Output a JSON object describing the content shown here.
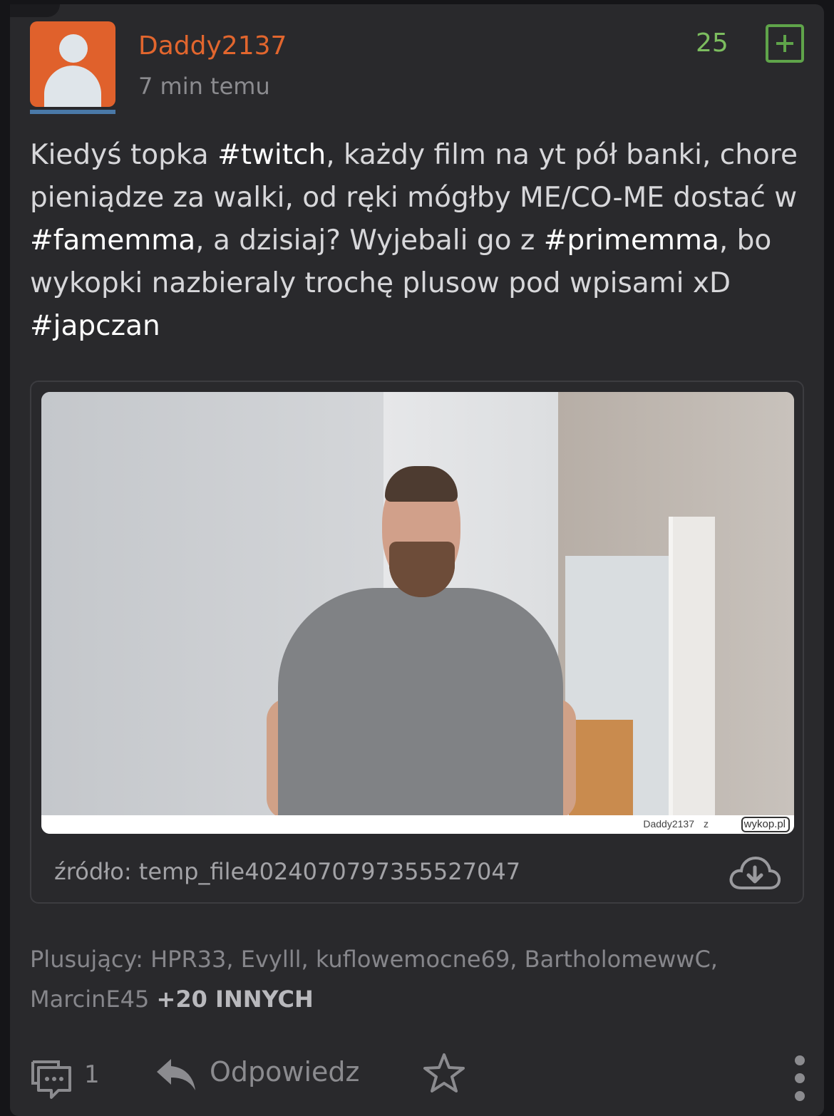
{
  "post": {
    "author": "Daddy2137",
    "time": "7 min temu",
    "votes": "25",
    "text_parts": {
      "p1": "Kiedyś topka ",
      "t1": "#twitch",
      "p2": ", każdy film na yt pół banki, chore pieniądze za walki, od ręki mógłby ME/CO-ME dostać w ",
      "t2": "#famemma",
      "p3": ", a dzisiaj? Wyjebali go z ",
      "t3": "#primemma",
      "p4": ", bo wykopki nazbieraly trochę plusow pod wpisami xD ",
      "t4": "#japczan"
    }
  },
  "embed": {
    "watermark_user": "Daddy2137",
    "watermark_z": "z",
    "watermark_site": "wykop.pl",
    "source": "źródło: temp_file4024070797355527047"
  },
  "plusers": {
    "label": "Plusujący: HPR33, Evylll, kuflowemocne69, BartholomewwC, MarcinE45",
    "more": "+20 INNYCH"
  },
  "actions": {
    "comments_count": "1",
    "reply_label": "Odpowiedz"
  },
  "colors": {
    "author": "#e2662e",
    "votes": "#7cbd5f",
    "background": "#29292c"
  },
  "icons": [
    "avatar",
    "plus-icon",
    "download-cloud-icon",
    "comments-icon",
    "reply-icon",
    "star-icon",
    "more-vertical-icon"
  ]
}
